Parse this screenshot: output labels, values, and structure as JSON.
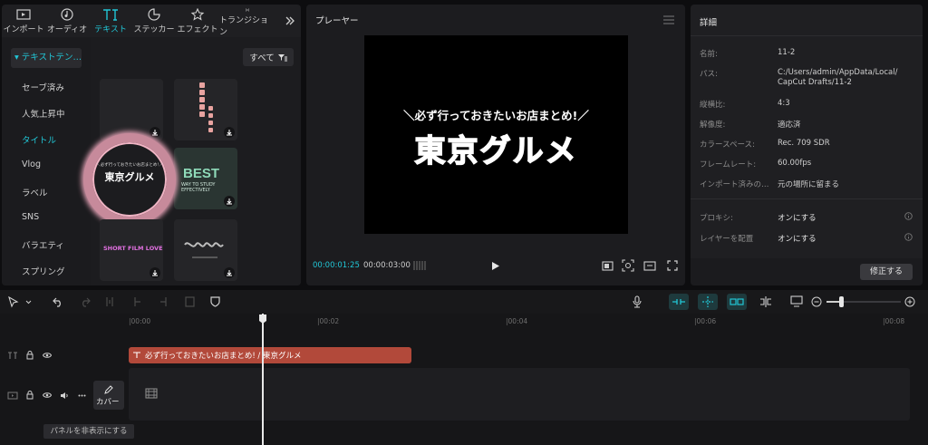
{
  "tabs": [
    {
      "label": "インポート",
      "icon": "import-icon"
    },
    {
      "label": "オーディオ",
      "icon": "audio-icon"
    },
    {
      "label": "テキスト",
      "icon": "text-icon"
    },
    {
      "label": "ステッカー",
      "icon": "sticker-icon"
    },
    {
      "label": "エフェクト",
      "icon": "effects-icon"
    },
    {
      "label": "トランジション",
      "icon": "transition-icon"
    }
  ],
  "sidebar": {
    "header": "▾ テキストテン…",
    "items": [
      "セーブ済み",
      "人気上昇中",
      "タイトル",
      "Vlog",
      "ラベル",
      "SNS",
      "バラエティ",
      "スプリング"
    ]
  },
  "grid": {
    "filter_label": "すべて",
    "thumb_texts": {
      "ring_small": "＼必ず行っておきたいお店まとめ!／",
      "ring_big": "東京グルメ",
      "best": "BEST",
      "best_sub": "WAY TO STUDY EFFECTIVELY",
      "short_film": "SHORT FILM LOVE"
    }
  },
  "player": {
    "title": "プレーヤー",
    "overlay_line1": "＼必ず行っておきたいお店まとめ!／",
    "overlay_line2": "東京グルメ",
    "current_time": "00:00:01:25",
    "total_time": "00:00:03:00"
  },
  "details": {
    "title": "詳細",
    "rows": [
      {
        "key": "名前:",
        "value": "11-2"
      },
      {
        "key": "パス:",
        "value": "C:/Users/admin/AppData/Local/",
        "value2": "CapCut Drafts/11-2"
      },
      {
        "key": "縦横比:",
        "value": "4:3"
      },
      {
        "key": "解像度:",
        "value": "適応済"
      },
      {
        "key": "カラースペース:",
        "value": "Rec. 709 SDR"
      },
      {
        "key": "フレームレート:",
        "value": "60.00fps"
      },
      {
        "key": "インポート済みの…",
        "value": "元の場所に留まる"
      }
    ],
    "proxy_key": "プロキシ:",
    "proxy_value": "オンにする",
    "layer_key": "レイヤーを配置",
    "layer_value": "オンにする",
    "modify_button": "修正する"
  },
  "timeline": {
    "ticks": [
      "|00:00",
      "|00:02",
      "|00:04",
      "|00:06",
      "|00:08"
    ],
    "text_clip": "必ず行っておきたいお店まとめ! / 東京グルメ",
    "cover_label": "カバー",
    "hide_panel_tooltip": "パネルを非表示にする"
  },
  "colors": {
    "accent": "#21c6d6",
    "clip": "#b2493a",
    "panel": "#1f1f22"
  }
}
